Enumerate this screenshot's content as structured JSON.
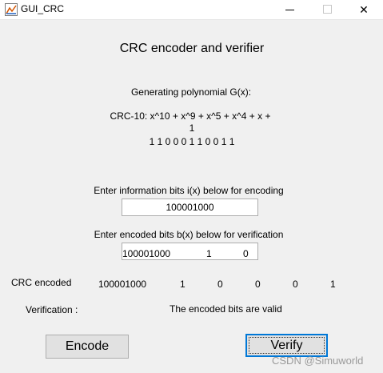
{
  "window": {
    "title": "GUI_CRC",
    "icon": "matlab-figure-icon",
    "controls": {
      "minimize": "minimize-icon",
      "maximize": "maximize-icon",
      "close": "✕"
    }
  },
  "heading": "CRC encoder and verifier",
  "polynomial": {
    "label": "Generating polynomial G(x):",
    "line1": "CRC-10: x^10 + x^9 + x^5 + x^4 + x +",
    "line2": "1",
    "bits": "1 1 0 0 0 1 1 0 0 1 1"
  },
  "encoding": {
    "label": "Enter information bits i(x) below for encoding",
    "value": "100001000"
  },
  "verification": {
    "label": "Enter encoded bits b(x) below for verification",
    "value_parts": [
      "100001000",
      "1",
      "0"
    ]
  },
  "crc_encoded": {
    "label": "CRC encoded",
    "parts": [
      "100001000",
      "1",
      "0",
      "0",
      "0",
      "1"
    ]
  },
  "verification_result": {
    "label": "Verification :",
    "message": "The encoded bits are valid"
  },
  "buttons": {
    "encode": "Encode",
    "verify": "Verify"
  },
  "watermark": "CSDN @Simuworld",
  "colors": {
    "background": "#f0f0f0",
    "focus_border": "#0078d7"
  }
}
